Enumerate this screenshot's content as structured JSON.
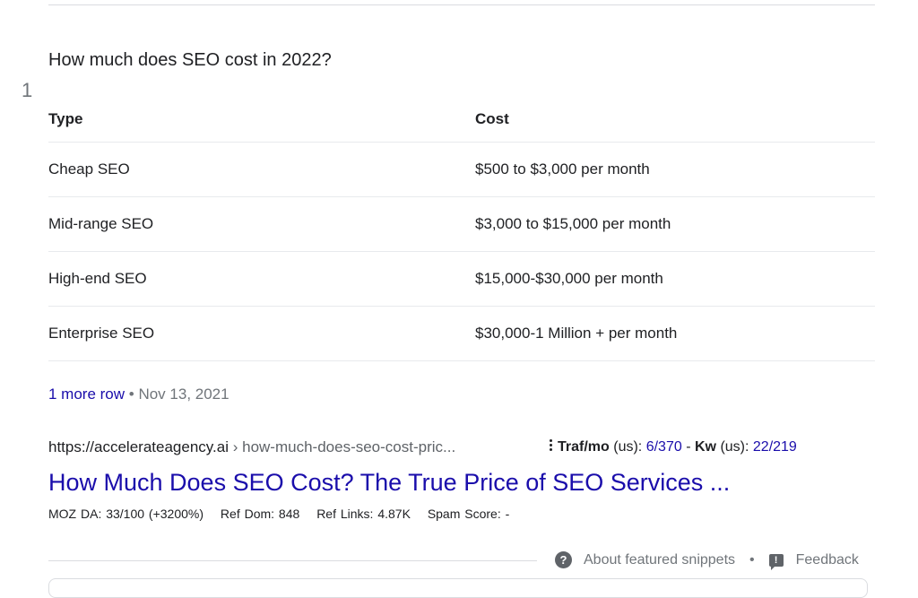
{
  "snippet": {
    "question": "How much does SEO cost in 2022?",
    "rank": "1",
    "table": {
      "headers": [
        "Type",
        "Cost"
      ],
      "rows": [
        [
          "Cheap SEO",
          "$500 to $3,000 per month"
        ],
        [
          "Mid-range SEO",
          "$3,000 to $15,000 per month"
        ],
        [
          "High-end SEO",
          "$15,000-$30,000 per month"
        ],
        [
          "Enterprise SEO",
          "$30,000-1 Million + per month"
        ]
      ]
    },
    "more_rows_link": "1 more row",
    "bullet": "•",
    "date": "Nov 13, 2021"
  },
  "result": {
    "url_domain": "https://accelerateagency.ai",
    "url_separator": "›",
    "url_path": "how-much-does-seo-cost-pric...",
    "traffic": {
      "traf_label": "Traf/mo",
      "traf_region": "(us):",
      "traf_value": "6/370",
      "dash": "-",
      "kw_label": "Kw",
      "kw_region": "(us):",
      "kw_value": "22/219"
    },
    "title": "How Much Does SEO Cost? The True Price of SEO Services ...",
    "metrics": {
      "moz": "MOZ DA: 33/100 (+3200%)",
      "ref_dom": "Ref Dom: 848",
      "ref_links": "Ref Links: 4.87K",
      "spam": "Spam Score: -"
    }
  },
  "footer": {
    "about_icon": "question-icon",
    "about_label": "About featured snippets",
    "bullet": "•",
    "feedback_icon": "feedback-icon",
    "feedback_label": "Feedback"
  },
  "colors": {
    "link": "#1a0dab",
    "text": "#202124",
    "muted": "#70757a",
    "divider": "#dadce0"
  }
}
